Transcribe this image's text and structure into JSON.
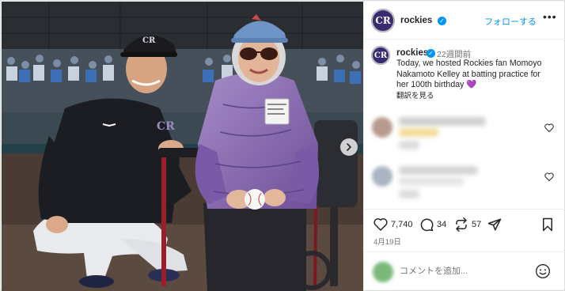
{
  "header": {
    "username": "rockies",
    "verified_mark": "✓",
    "follow_label": "フォローする",
    "more_label": "•••",
    "avatar_text": "CR"
  },
  "caption": {
    "username": "rockies",
    "time": "22週間前",
    "text_line1": "Today, we hosted Rockies fan Momoyo",
    "text_line2": "Nakamoto Kelley at batting practice for",
    "text_line3": "her 100th birthday ",
    "heart": "💜",
    "translate_label": "翻訳を見る",
    "avatar_text": "CR"
  },
  "comments": [
    {
      "blurred": true,
      "avatar_color": "#b89a8e",
      "line_color": "#f2dc9a",
      "sub_color": "#dcdcdc"
    },
    {
      "blurred": true,
      "avatar_color": "#aab4c2",
      "line_color": "#e6e6e6",
      "sub_color": "#dcdcdc"
    }
  ],
  "actions": {
    "like_count": "7,740",
    "comment_count": "34",
    "repost_count": "57",
    "date": "4月19日"
  },
  "composer": {
    "placeholder": "コメントを追加..."
  },
  "photo": {
    "cap_logo_text": "CR",
    "jersey_logo_text": "CR",
    "badge_text": "",
    "icons": [
      "next-arrow-icon"
    ]
  },
  "colors": {
    "accent_blue": "#0095f6",
    "rockies_purple": "#3a2a72",
    "jacket_purple": "#8a6bb1"
  }
}
